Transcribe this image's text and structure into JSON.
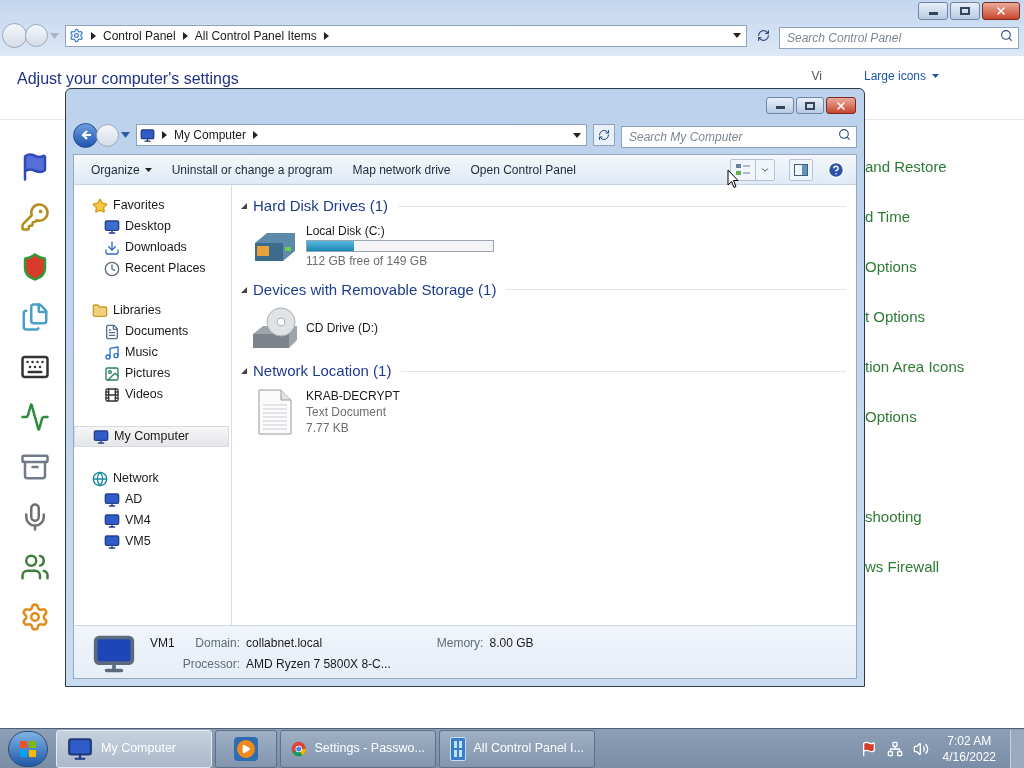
{
  "background_window": {
    "breadcrumb": [
      "Control Panel",
      "All Control Panel Items"
    ],
    "search_placeholder": "Search Control Panel",
    "heading": "Adjust your computer's settings",
    "view_by_fragment": "Vi",
    "view_mode": "Large icons",
    "items": [
      {
        "kind": "link",
        "label": "and Restore"
      },
      {
        "kind": "link",
        "label": "d Time"
      },
      {
        "kind": "link",
        "label": "Options"
      },
      {
        "kind": "link",
        "label": "t Options"
      },
      {
        "kind": "link",
        "label": "tion Area Icons"
      },
      {
        "kind": "link",
        "label": "Options"
      },
      {
        "kind": "icon"
      },
      {
        "kind": "link",
        "label": "shooting"
      },
      {
        "kind": "link",
        "label": "ws Firewall"
      },
      {
        "kind": "icon"
      }
    ]
  },
  "explorer": {
    "breadcrumb": [
      "My Computer"
    ],
    "search_placeholder": "Search My Computer",
    "toolbar": [
      {
        "label": "Organize",
        "dropdown": true
      },
      {
        "label": "Uninstall or change a program",
        "dropdown": false
      },
      {
        "label": "Map network drive",
        "dropdown": false
      },
      {
        "label": "Open Control Panel",
        "dropdown": false
      }
    ],
    "nav": [
      {
        "kind": "favorites",
        "label": "Favorites",
        "selected": false,
        "children": [
          {
            "kind": "desktop",
            "label": "Desktop",
            "selected": false
          },
          {
            "kind": "downloads",
            "label": "Downloads",
            "selected": false
          },
          {
            "kind": "recent",
            "label": "Recent Places",
            "selected": false
          }
        ]
      },
      {
        "kind": "libraries",
        "label": "Libraries",
        "selected": false,
        "children": [
          {
            "kind": "documents",
            "label": "Documents",
            "selected": false
          },
          {
            "kind": "music",
            "label": "Music",
            "selected": false
          },
          {
            "kind": "pictures",
            "label": "Pictures",
            "selected": false
          },
          {
            "kind": "videos",
            "label": "Videos",
            "selected": false
          }
        ]
      },
      {
        "kind": "computer",
        "label": "My Computer",
        "selected": true
      },
      {
        "kind": "network",
        "label": "Network",
        "selected": false,
        "children": [
          {
            "kind": "computer",
            "label": "AD",
            "selected": false
          },
          {
            "kind": "computer",
            "label": "VM4",
            "selected": false
          },
          {
            "kind": "computer",
            "label": "VM5",
            "selected": false
          }
        ]
      }
    ],
    "sections": [
      {
        "title": "Hard Disk Drives (1)",
        "items": [
          {
            "kind": "disk",
            "name": "Local Disk (C:)",
            "level": 0.25,
            "free": "112 GB free of 149 GB"
          }
        ]
      },
      {
        "title": "Devices with Removable Storage (1)",
        "items": [
          {
            "kind": "cd",
            "name": "CD Drive (D:)"
          }
        ]
      },
      {
        "title": "Network Location (1)",
        "items": [
          {
            "kind": "file",
            "name": "KRAB-DECRYPT",
            "type": "Text Document",
            "size": "7.77 KB"
          }
        ]
      }
    ],
    "details": {
      "name": "VM1",
      "fields": [
        {
          "label": "Domain:",
          "value": "collabnet.local"
        },
        {
          "label": "Memory:",
          "value": "8.00 GB"
        },
        {
          "label": "Processor:",
          "value": "AMD Ryzen 7 5800X 8-C..."
        }
      ]
    }
  },
  "taskbar": {
    "buttons": [
      {
        "kind": "computer",
        "label": "My Computer",
        "selected": true
      },
      {
        "kind": "media",
        "selected": false
      },
      {
        "kind": "browser",
        "label": "Settings - Passwo...",
        "selected": false
      },
      {
        "kind": "control",
        "label": "All Control Panel I...",
        "selected": false
      }
    ],
    "time": "7:02 AM",
    "date": "4/16/2022"
  }
}
